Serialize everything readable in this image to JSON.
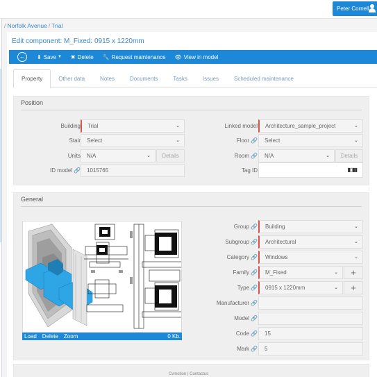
{
  "header": {
    "user_name": "Peter Cornell",
    "user_icon": "user-icon"
  },
  "breadcrumb": {
    "prefix": "/",
    "item1": "Norfolk Avenue",
    "sep": "/",
    "item2": "Trial"
  },
  "page": {
    "title": "Edit component: M_Fixed: 0915 x 1220mm"
  },
  "toolbar": {
    "back_icon": "back-arrow-icon",
    "save_label": "Save",
    "delete_label": "Delete",
    "maintenance_label": "Request maintenance",
    "view_label": "View in model"
  },
  "tabs": [
    {
      "label": "Property",
      "active": true
    },
    {
      "label": "Other data"
    },
    {
      "label": "Notes"
    },
    {
      "label": "Documents"
    },
    {
      "label": "Tasks"
    },
    {
      "label": "Issues"
    },
    {
      "label": "Scheduled maintenance"
    }
  ],
  "position": {
    "heading": "Position",
    "building_label": "Building",
    "building_value": "Trial",
    "stair_label": "Stair",
    "stair_value": "Select",
    "units_label": "Units",
    "units_value": "N/A",
    "units_details": "Details",
    "idmodel_label": "ID model",
    "idmodel_value": "1015765",
    "linked_label": "Linked model",
    "linked_value": "Architecture_sample_project",
    "floor_label": "Floor",
    "floor_value": "Select",
    "room_label": "Room",
    "room_value": "N/A",
    "room_details": "Details",
    "tagid_label": "Tag ID",
    "tagid_value": ""
  },
  "general": {
    "heading": "General",
    "image_actions": {
      "load": "Load",
      "delete": "Delete",
      "zoom": "Zoom",
      "size": "0 Kb."
    },
    "group_label": "Group",
    "group_value": "Building",
    "subgroup_label": "Subgroup",
    "subgroup_value": "Architectural",
    "category_label": "Category",
    "category_value": "Windows",
    "family_label": "Family",
    "family_value": "M_Fixed",
    "type_label": "Type",
    "type_value": "0915 x 1220mm",
    "manufacturer_label": "Manufacturer",
    "manufacturer_value": "",
    "model_label": "Model",
    "model_value": "",
    "code_label": "Code",
    "code_value": "15",
    "mark_label": "Mark",
    "mark_value": "5"
  },
  "footer": {
    "text": "Cvmotion | Contactus"
  },
  "colors": {
    "accent": "#1e88d8",
    "link": "#3a86c8",
    "required": "#d9534f",
    "render_blue": "#2ea6e6"
  }
}
